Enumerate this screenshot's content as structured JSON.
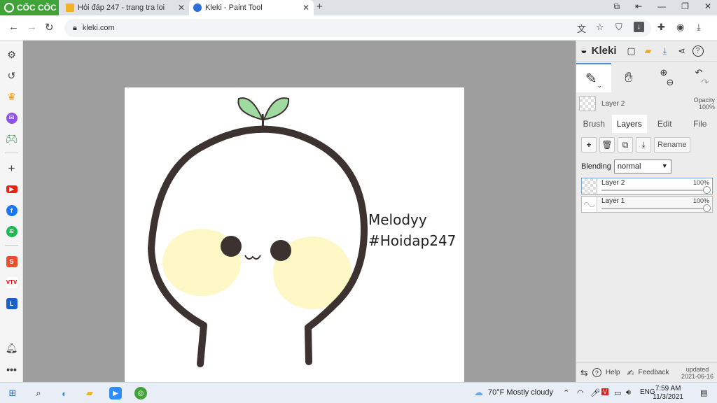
{
  "browser": {
    "brand": "CỐC CỐC",
    "tabs": [
      {
        "title": "Hỏi đáp 247 - trang tra loi",
        "fav_color": "#f3b320"
      },
      {
        "title": "Kleki - Paint Tool",
        "fav_color": "#2a6fd6"
      }
    ],
    "address": "kleki.com",
    "nav_icons": [
      "back-arrow-icon",
      "forward-arrow-icon",
      "reload-icon"
    ],
    "window_icons": [
      "cast-icon",
      "restore-left-icon",
      "minimize-icon",
      "maximize-icon",
      "close-icon"
    ],
    "address_icons": [
      "translate-icon",
      "star-icon",
      "shield-icon",
      "download-box-icon",
      "puzzle-icon",
      "account-icon",
      "download-icon"
    ]
  },
  "left_sidebar": {
    "icons": [
      "gear-icon",
      "history-icon",
      "crown-icon",
      "messenger-icon",
      "game-icon",
      "plus-icon",
      "youtube-icon",
      "facebook-icon",
      "spotify-icon",
      "shopee-icon",
      "vtv-icon",
      "lazada-icon",
      "bell-icon",
      "more-icon"
    ]
  },
  "canvas": {
    "text_line1": "Melodyy",
    "text_line2": "#Hoidap247",
    "colors": {
      "outline": "#3c3331",
      "cheek": "#fdf8c6",
      "leaf": "#9fdba0",
      "bg": "#9e9e9e"
    }
  },
  "kleki": {
    "title": "Kleki",
    "header_icons": [
      "new-image-icon",
      "open-folder-icon",
      "download-icon",
      "share-icon",
      "help-icon"
    ],
    "tools": [
      "brush-tool-icon",
      "hand-tool-icon",
      "zoom-in-icon",
      "undo-icon"
    ],
    "active_layer": {
      "name": "Layer 2",
      "opacity_label": "Opacity",
      "opacity_value": "100%"
    },
    "panel_tabs": [
      "Brush",
      "Layers",
      "Edit",
      "File"
    ],
    "active_tab": "Layers",
    "actions": {
      "add": "+",
      "rename": "Rename"
    },
    "blending_label": "Blending",
    "blending_value": "normal",
    "layers": [
      {
        "name": "Layer 2",
        "opacity": "100%",
        "active": true
      },
      {
        "name": "Layer 1",
        "opacity": "100%",
        "active": false
      }
    ],
    "footer": {
      "help": "Help",
      "feedback": "Feedback",
      "updated_label": "updated",
      "updated_date": "2021-06-16"
    }
  },
  "taskbar": {
    "weather": "70°F  Mostly cloudy",
    "lang": "ENG",
    "time": "7:59 AM",
    "date": "11/3/2021"
  }
}
